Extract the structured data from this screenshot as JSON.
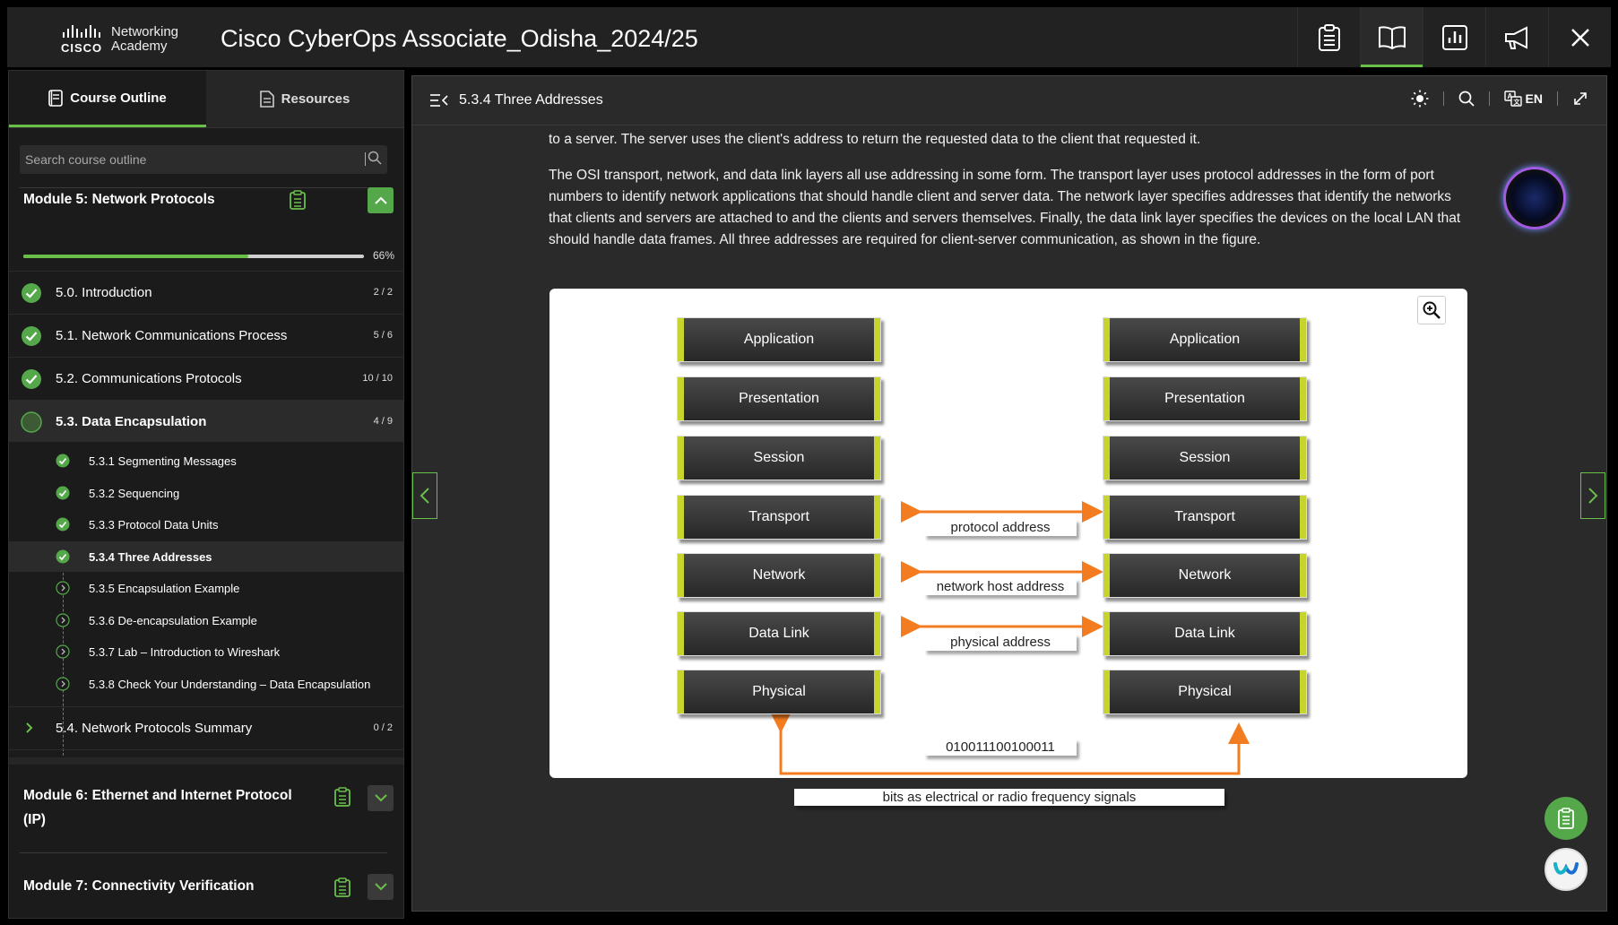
{
  "app": {
    "brand_line1": "Networking",
    "brand_line2": "Academy",
    "brand_cisco": "CISCO",
    "title": "Cisco CyberOps Associate_Odisha_2024/25",
    "top_icons": [
      "clipboard-icon",
      "book-icon",
      "chart-icon",
      "megaphone-icon",
      "close-icon"
    ]
  },
  "sidebar": {
    "tabs": [
      {
        "label": "Course Outline",
        "active": true
      },
      {
        "label": "Resources",
        "active": false
      }
    ],
    "search_placeholder": "Search course outline",
    "modules": [
      {
        "title": "Module 5: Network Protocols",
        "progress_percent": 66,
        "progress_label": "66%",
        "expanded": true,
        "topics": [
          {
            "label": "5.0. Introduction",
            "count": "2 / 2",
            "status": "complete"
          },
          {
            "label": "5.1. Network Communications Process",
            "count": "5 / 6",
            "status": "complete"
          },
          {
            "label": "5.2. Communications Protocols",
            "count": "10 / 10",
            "status": "complete"
          },
          {
            "label": "5.3. Data Encapsulation",
            "count": "4 / 9",
            "status": "in-progress"
          },
          {
            "label": "5.4. Network Protocols Summary",
            "count": "0 / 2",
            "status": "collapsed"
          }
        ],
        "subtopics": [
          {
            "label": "5.3.1 Segmenting Messages",
            "status": "complete"
          },
          {
            "label": "5.3.2 Sequencing",
            "status": "complete"
          },
          {
            "label": "5.3.3 Protocol Data Units",
            "status": "complete"
          },
          {
            "label": "5.3.4 Three Addresses",
            "status": "complete"
          },
          {
            "label": "5.3.5 Encapsulation Example",
            "status": "pending"
          },
          {
            "label": "5.3.6 De-encapsulation Example",
            "status": "pending"
          },
          {
            "label": "5.3.7 Lab – Introduction to Wireshark",
            "status": "pending"
          },
          {
            "label": "5.3.8 Check Your Understanding – Data Encapsulation",
            "status": "pending"
          }
        ]
      },
      {
        "title_line1": "Module 6: Ethernet and Internet Protocol",
        "title_line2": "(IP)",
        "expanded": false
      },
      {
        "title": "Module 7: Connectivity Verification",
        "expanded": false
      }
    ]
  },
  "main": {
    "page_title": "5.3.4 Three Addresses",
    "language": "EN",
    "para1": "to a server. The server uses the client's address to return the requested data to the client that requested it.",
    "para2": "The OSI transport, network, and data link layers all use addressing in some form. The transport layer uses protocol addresses in the form of port numbers to identify network applications that should handle client and server data. The network layer specifies addresses that identify the networks that clients and servers are attached to and the clients and servers themselves. Finally, the data link layer specifies the devices on the local LAN that should handle data frames. All three addresses are required for client-server communication, as shown in the figure."
  },
  "figure": {
    "left_layers": [
      "Application",
      "Presentation",
      "Session",
      "Transport",
      "Network",
      "Data Link",
      "Physical"
    ],
    "right_layers": [
      "Application",
      "Presentation",
      "Session",
      "Transport",
      "Network",
      "Data Link",
      "Physical"
    ],
    "addresses": [
      "protocol address",
      "network host address",
      "physical address"
    ],
    "bits": "010011100100011",
    "signal_label": "bits as electrical or radio frequency signals",
    "arrow_color": "#f47c20",
    "layer_edge_color": "#c8d42e"
  },
  "colors": {
    "accent": "#6abf4b",
    "background": "#2a2a2b"
  }
}
